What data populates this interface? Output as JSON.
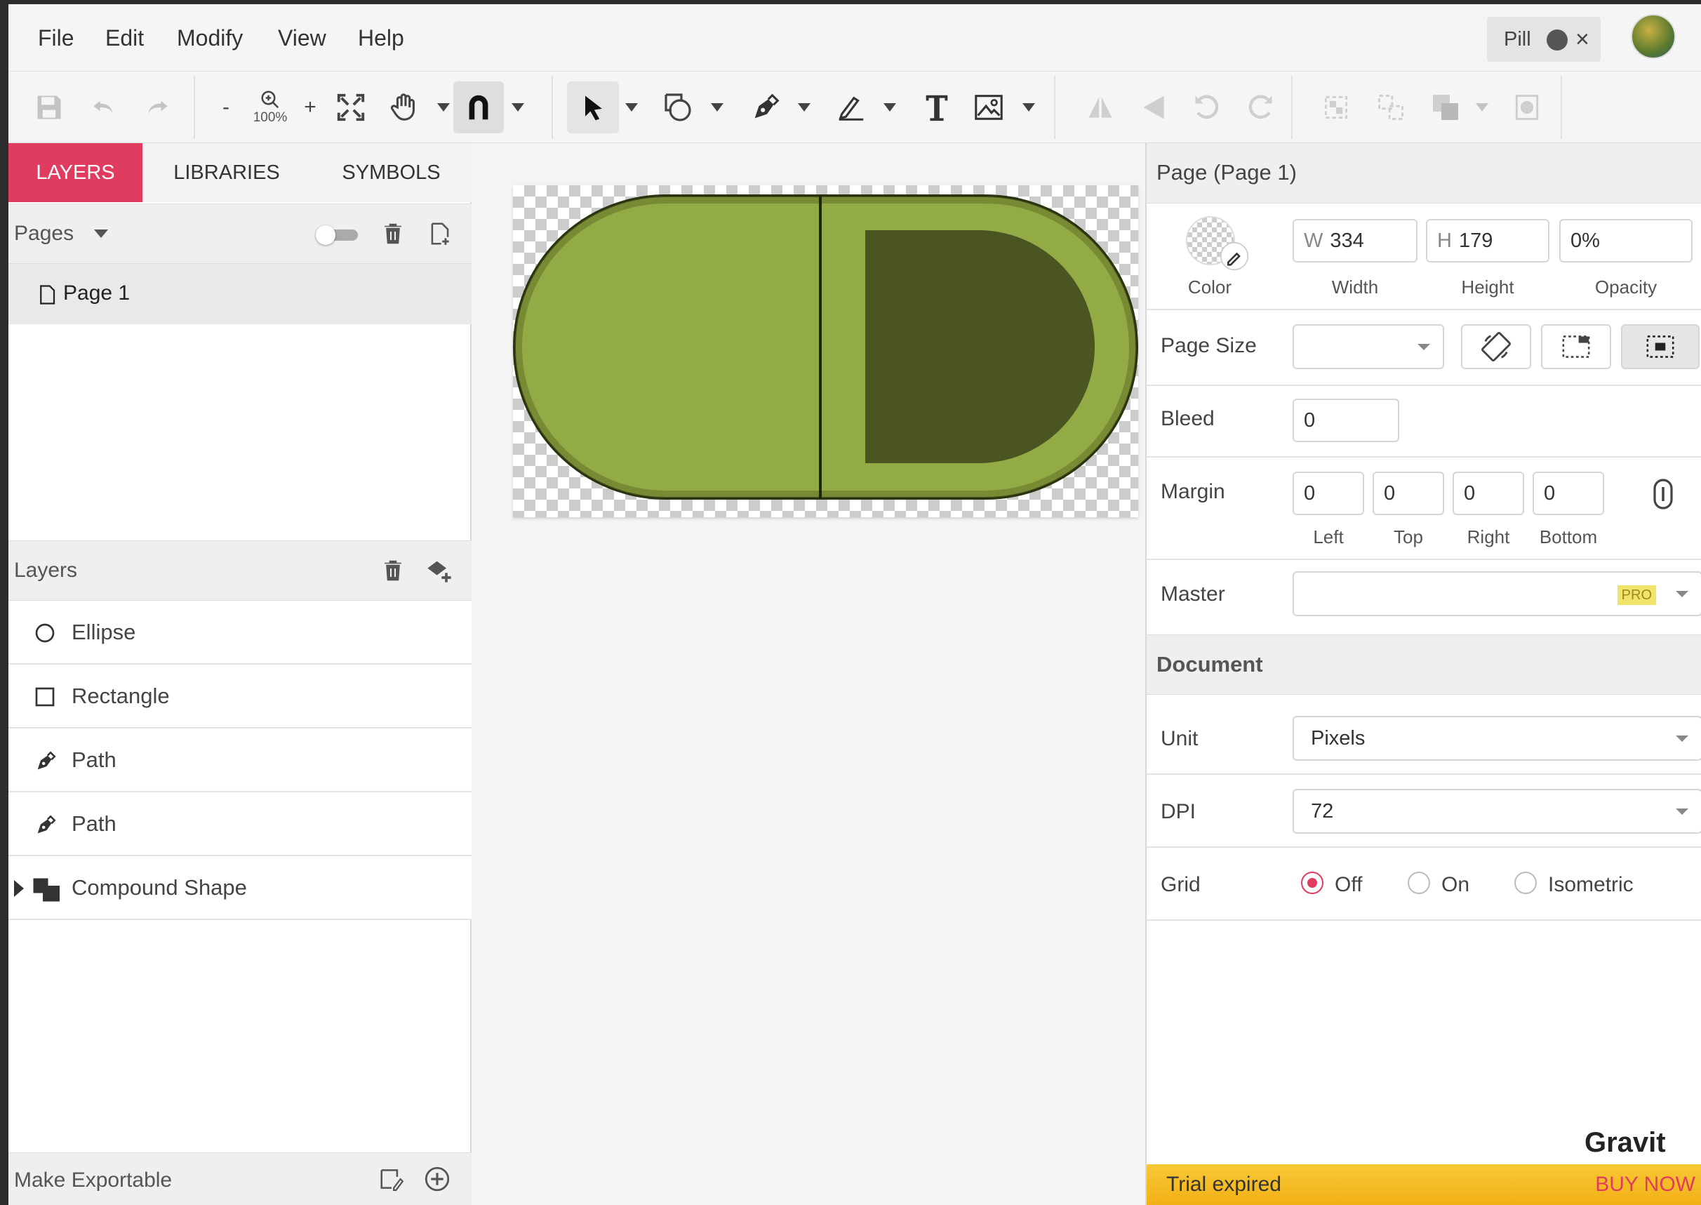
{
  "menu": {
    "file": "File",
    "edit": "Edit",
    "modify": "Modify",
    "view": "View",
    "help": "Help"
  },
  "doc_tab": {
    "title": "Pill",
    "close": "×"
  },
  "toolbar": {
    "zoom_minus": "-",
    "zoom_plus": "+",
    "zoom_level": "100%"
  },
  "left": {
    "tabs": {
      "layers": "LAYERS",
      "libraries": "LIBRARIES",
      "symbols": "SYMBOLS"
    },
    "pages_label": "Pages",
    "page_item": "Page 1",
    "layers_label": "Layers",
    "layers": [
      {
        "name": "Ellipse",
        "icon": "ellipse-icon"
      },
      {
        "name": "Rectangle",
        "icon": "rectangle-icon"
      },
      {
        "name": "Path",
        "icon": "pen-icon"
      },
      {
        "name": "Path",
        "icon": "pen-icon"
      },
      {
        "name": "Compound Shape",
        "icon": "compound-shape-icon"
      }
    ],
    "make_exportable": "Make Exportable"
  },
  "right": {
    "page_header": "Page (Page 1)",
    "color_label": "Color",
    "width": {
      "prefix": "W",
      "value": "334",
      "label": "Width"
    },
    "height": {
      "prefix": "H",
      "value": "179",
      "label": "Height"
    },
    "opacity": {
      "value": "0%",
      "label": "Opacity"
    },
    "page_size_label": "Page Size",
    "page_size_value": "",
    "bleed_label": "Bleed",
    "bleed_value": "0",
    "margin_label": "Margin",
    "margin": {
      "left": "0",
      "top": "0",
      "right": "0",
      "bottom": "0"
    },
    "margin_sublabels": {
      "left": "Left",
      "top": "Top",
      "right": "Right",
      "bottom": "Bottom"
    },
    "master_label": "Master",
    "master_badge": "PRO",
    "document_header": "Document",
    "unit_label": "Unit",
    "unit_value": "Pixels",
    "dpi_label": "DPI",
    "dpi_value": "72",
    "grid_label": "Grid",
    "grid_options": {
      "off": "Off",
      "on": "On",
      "isometric": "Isometric"
    },
    "grid_selected": "Off",
    "brand": "Gravit",
    "trial_text": "Trial expired",
    "buy_now": "BUY NOW"
  },
  "colors": {
    "accent": "#e03c5f",
    "pill_light": "#93ab45",
    "pill_dark": "#4a5522",
    "pill_outline": "#2b3310",
    "trial_bg": "#f2b015"
  }
}
